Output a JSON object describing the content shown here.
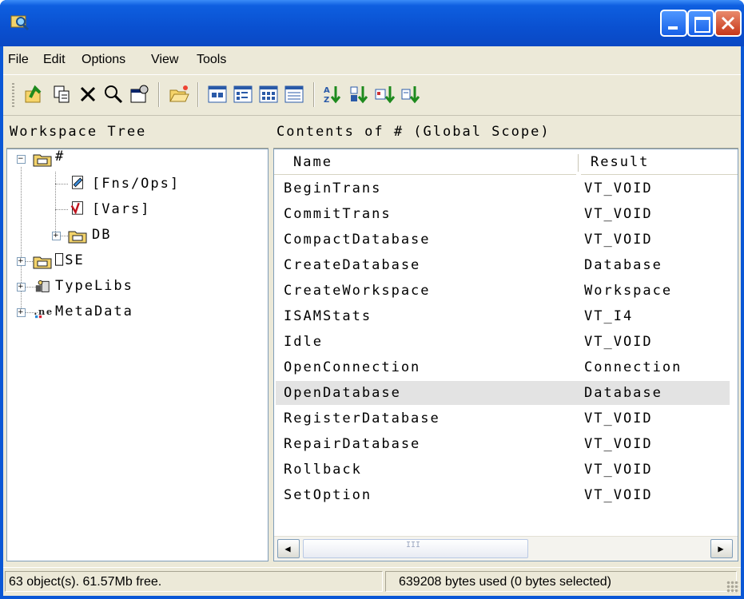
{
  "window": {
    "title": ""
  },
  "menu": [
    "File",
    "Edit",
    "Options",
    "View",
    "Tools"
  ],
  "toolbar": {
    "icons": [
      "up-folder-icon",
      "copy-icon",
      "delete-icon",
      "find-icon",
      "properties-icon",
      "open-folder-icon",
      "large-icons-icon",
      "small-icons-icon",
      "list-view-icon",
      "details-view-icon",
      "sort-by-name-icon",
      "sort-by-type-icon",
      "sort-by-size-icon",
      "sort-by-date-icon"
    ]
  },
  "left_pane": {
    "header": "Workspace Tree",
    "tree": {
      "root": "#",
      "root_children": [
        "[Fns/Ops]",
        "[Vars]",
        "DB"
      ],
      "siblings": [
        "⎕SE",
        "TypeLibs",
        "MetaData"
      ]
    }
  },
  "right_pane": {
    "header": "Contents of # (Global Scope)",
    "columns": {
      "name": "Name",
      "result": "Result"
    },
    "rows": [
      {
        "name": "BeginTrans",
        "result": "VT_VOID"
      },
      {
        "name": "CommitTrans",
        "result": "VT_VOID"
      },
      {
        "name": "CompactDatabase",
        "result": "VT_VOID"
      },
      {
        "name": "CreateDatabase",
        "result": "Database"
      },
      {
        "name": "CreateWorkspace",
        "result": "Workspace"
      },
      {
        "name": "ISAMStats",
        "result": "VT_I4"
      },
      {
        "name": "Idle",
        "result": "VT_VOID"
      },
      {
        "name": "OpenConnection",
        "result": "Connection"
      },
      {
        "name": "OpenDatabase",
        "result": "Database"
      },
      {
        "name": "RegisterDatabase",
        "result": "VT_VOID"
      },
      {
        "name": "RepairDatabase",
        "result": "VT_VOID"
      },
      {
        "name": "Rollback",
        "result": "VT_VOID"
      },
      {
        "name": "SetOption",
        "result": "VT_VOID"
      }
    ],
    "selected_row": "OpenDatabase",
    "scroll": {
      "track_glyph": "III"
    }
  },
  "status": {
    "left": "63 object(s). 61.57Mb free.",
    "right": "639208 bytes used (0 bytes selected)"
  }
}
